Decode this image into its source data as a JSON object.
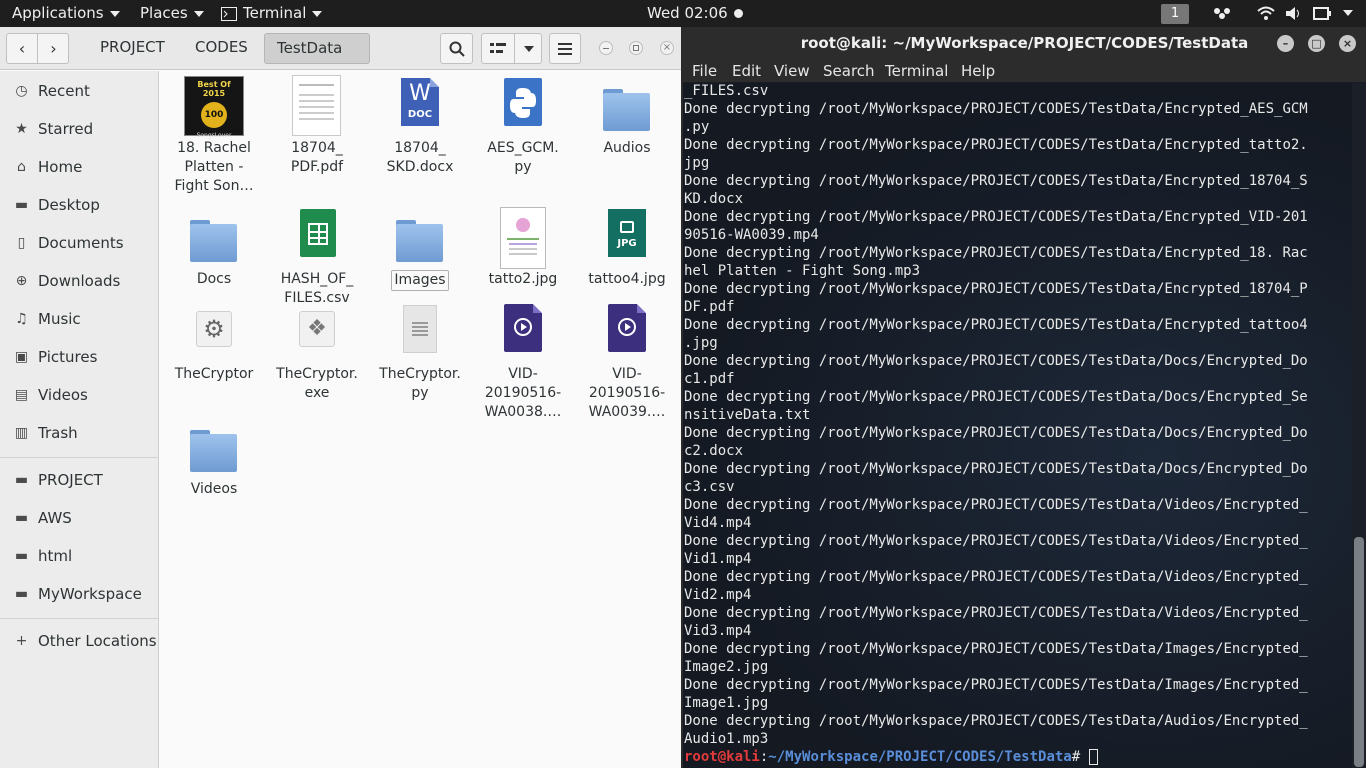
{
  "topbar": {
    "applications": "Applications",
    "places": "Places",
    "terminal": "Terminal",
    "clock": "Wed 02:06",
    "workspace": "1"
  },
  "files": {
    "breadcrumbs": [
      "PROJECT",
      "CODES",
      "TestData"
    ],
    "sidebar": [
      "Recent",
      "Starred",
      "Home",
      "Desktop",
      "Documents",
      "Downloads",
      "Music",
      "Pictures",
      "Videos",
      "Trash"
    ],
    "bookmarks": [
      "PROJECT",
      "AWS",
      "html",
      "MyWorkspace"
    ],
    "other": "Other Locations",
    "items": [
      {
        "name": "18. Rachel Platten - Fight Son…",
        "lines": [
          "18. Rachel",
          "Platten -",
          "Fight Son…"
        ],
        "type": "album",
        "art_title": "Best Of 2015",
        "art_badge": "100",
        "art_footer": "SongsLover"
      },
      {
        "name": "18704_PDF.pdf",
        "lines": [
          "18704_",
          "PDF.pdf"
        ],
        "type": "pdf"
      },
      {
        "name": "18704_SKD.docx",
        "lines": [
          "18704_",
          "SKD.docx"
        ],
        "type": "doc",
        "badge": "DOC",
        "glyph": "W"
      },
      {
        "name": "AES_GCM.py",
        "lines": [
          "AES_GCM.",
          "py"
        ],
        "type": "python"
      },
      {
        "name": "Audios",
        "lines": [
          "Audios"
        ],
        "type": "folder"
      },
      {
        "name": "Docs",
        "lines": [
          "Docs"
        ],
        "type": "folder"
      },
      {
        "name": "HASH_OF_FILES.csv",
        "lines": [
          "HASH_OF_",
          "FILES.csv"
        ],
        "type": "sheet"
      },
      {
        "name": "Images",
        "lines": [
          "Images"
        ],
        "type": "folder",
        "selected": true
      },
      {
        "name": "tatto2.jpg",
        "lines": [
          "tatto2.jpg"
        ],
        "type": "image"
      },
      {
        "name": "tattoo4.jpg",
        "lines": [
          "tattoo4.jpg"
        ],
        "type": "jpg",
        "badge": "JPG"
      },
      {
        "name": "TheCryptor",
        "lines": [
          "TheCryptor"
        ],
        "type": "exec"
      },
      {
        "name": "TheCryptor.exe",
        "lines": [
          "TheCryptor.",
          "exe"
        ],
        "type": "exe"
      },
      {
        "name": "TheCryptor.py",
        "lines": [
          "TheCryptor.",
          "py"
        ],
        "type": "text"
      },
      {
        "name": "VID-20190516-WA0038…",
        "lines": [
          "VID-",
          "20190516-",
          "WA0038.…"
        ],
        "type": "video"
      },
      {
        "name": "VID-20190516-WA0039…",
        "lines": [
          "VID-",
          "20190516-",
          "WA0039.…"
        ],
        "type": "video"
      },
      {
        "name": "Videos",
        "lines": [
          "Videos"
        ],
        "type": "folder"
      }
    ]
  },
  "terminal": {
    "title": "root@kali: ~/MyWorkspace/PROJECT/CODES/TestData",
    "menu": [
      "File",
      "Edit",
      "View",
      "Search",
      "Terminal",
      "Help"
    ],
    "lines": [
      "_FILES.csv",
      "Done decrypting /root/MyWorkspace/PROJECT/CODES/TestData/Encrypted_AES_GCM",
      ".py",
      "Done decrypting /root/MyWorkspace/PROJECT/CODES/TestData/Encrypted_tatto2.",
      "jpg",
      "Done decrypting /root/MyWorkspace/PROJECT/CODES/TestData/Encrypted_18704_S",
      "KD.docx",
      "Done decrypting /root/MyWorkspace/PROJECT/CODES/TestData/Encrypted_VID-201",
      "90516-WA0039.mp4",
      "Done decrypting /root/MyWorkspace/PROJECT/CODES/TestData/Encrypted_18. Rac",
      "hel Platten - Fight Song.mp3",
      "Done decrypting /root/MyWorkspace/PROJECT/CODES/TestData/Encrypted_18704_P",
      "DF.pdf",
      "Done decrypting /root/MyWorkspace/PROJECT/CODES/TestData/Encrypted_tattoo4",
      ".jpg",
      "Done decrypting /root/MyWorkspace/PROJECT/CODES/TestData/Docs/Encrypted_Do",
      "c1.pdf",
      "Done decrypting /root/MyWorkspace/PROJECT/CODES/TestData/Docs/Encrypted_Se",
      "nsitiveData.txt",
      "Done decrypting /root/MyWorkspace/PROJECT/CODES/TestData/Docs/Encrypted_Do",
      "c2.docx",
      "Done decrypting /root/MyWorkspace/PROJECT/CODES/TestData/Docs/Encrypted_Do",
      "c3.csv",
      "Done decrypting /root/MyWorkspace/PROJECT/CODES/TestData/Videos/Encrypted_",
      "Vid4.mp4",
      "Done decrypting /root/MyWorkspace/PROJECT/CODES/TestData/Videos/Encrypted_",
      "Vid1.mp4",
      "Done decrypting /root/MyWorkspace/PROJECT/CODES/TestData/Videos/Encrypted_",
      "Vid2.mp4",
      "Done decrypting /root/MyWorkspace/PROJECT/CODES/TestData/Videos/Encrypted_",
      "Vid3.mp4",
      "Done decrypting /root/MyWorkspace/PROJECT/CODES/TestData/Images/Encrypted_",
      "Image2.jpg",
      "Done decrypting /root/MyWorkspace/PROJECT/CODES/TestData/Images/Encrypted_",
      "Image1.jpg",
      "Done decrypting /root/MyWorkspace/PROJECT/CODES/TestData/Audios/Encrypted_",
      "Audio1.mp3"
    ],
    "prompt_user": "root@kali",
    "prompt_sep": ":",
    "prompt_path": "~/MyWorkspace/PROJECT/CODES/TestData",
    "prompt_end": "# "
  }
}
